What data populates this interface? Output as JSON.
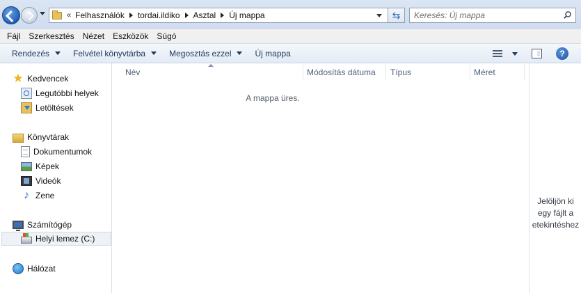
{
  "address_bar": {
    "chevron": "«",
    "crumbs": [
      "Felhasználók",
      "tordai.ildiko",
      "Asztal",
      "Új mappa"
    ]
  },
  "search": {
    "placeholder": "Keresés: Új mappa"
  },
  "menu": [
    "Fájl",
    "Szerkesztés",
    "Nézet",
    "Eszközök",
    "Súgó"
  ],
  "toolbar": {
    "organize": "Rendezés",
    "include_library": "Felvétel könyvtárba",
    "share_with": "Megosztás ezzel",
    "new_folder": "Új mappa",
    "help": "?"
  },
  "nav": {
    "favorites": "Kedvencek",
    "recent_places": "Legutóbbi helyek",
    "downloads": "Letöltések",
    "libraries": "Könyvtárak",
    "documents": "Dokumentumok",
    "pictures": "Képek",
    "videos": "Videók",
    "music": "Zene",
    "computer": "Számítógép",
    "local_disk": "Helyi lemez (C:)",
    "network": "Hálózat"
  },
  "columns": {
    "name": "Név",
    "date_modified": "Módosítás dátuma",
    "type": "Típus",
    "size": "Méret"
  },
  "content": {
    "empty_message": "A mappa üres."
  },
  "preview": {
    "line1": "Jelöljön ki",
    "line2": "egy fájlt a",
    "line3": "etekintéshez"
  },
  "colors": {
    "accent": "#2b69c2",
    "toolbar_text": "#1e395b"
  }
}
